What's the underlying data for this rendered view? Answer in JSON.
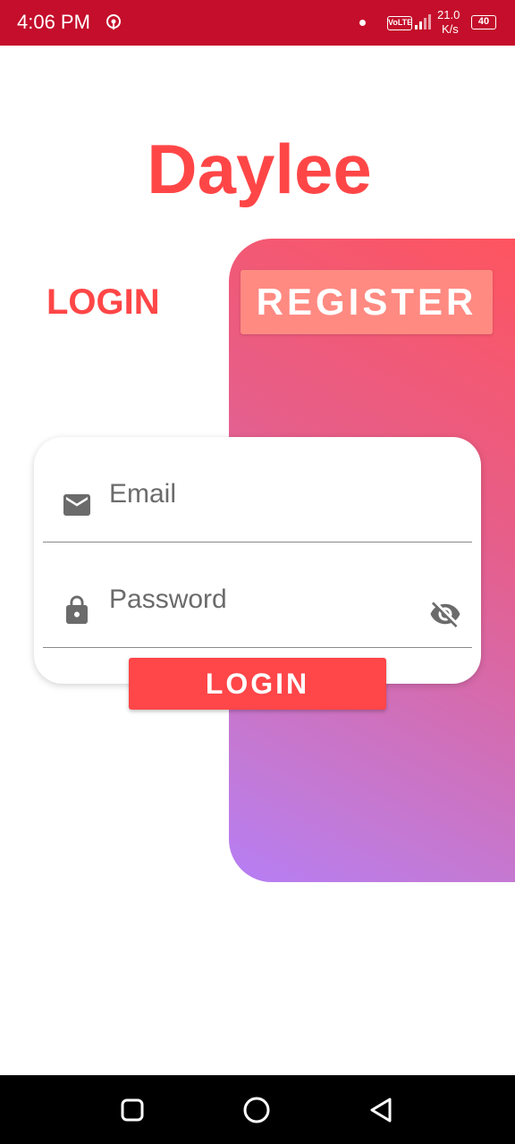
{
  "status_bar": {
    "time": "4:06 PM",
    "network_badge": "VoLTE",
    "speed_value": "21.0",
    "speed_unit": "K/s",
    "battery": "40",
    "icons": [
      "hotspot-icon",
      "notification-dot-icon",
      "signal-icon",
      "battery-icon"
    ]
  },
  "app": {
    "title": "Daylee",
    "brand_color": "#ff4647",
    "gradient_colors": [
      "#ff545e",
      "#e65e8a",
      "#b67ef5"
    ]
  },
  "tabs": {
    "login_label": "LOGIN",
    "register_label": "REGISTER"
  },
  "form": {
    "email_placeholder": "Email",
    "email_value": "",
    "password_placeholder": "Password",
    "password_value": "",
    "icons": [
      "email-icon",
      "lock-icon",
      "visibility-off-icon"
    ],
    "submit_label": "LOGIN"
  },
  "nav_bar": {
    "icons": [
      "recent-apps-icon",
      "home-icon",
      "back-icon"
    ]
  }
}
